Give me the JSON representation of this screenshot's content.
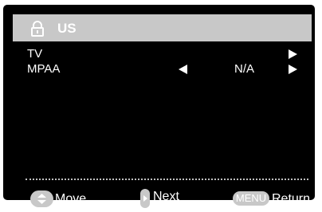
{
  "header": {
    "title": "US",
    "icon": "lock-icon"
  },
  "rows": [
    {
      "label": "TV",
      "value": "",
      "has_left_arrow": false,
      "has_right_arrow": true
    },
    {
      "label": "MPAA",
      "value": "N/A",
      "has_left_arrow": true,
      "has_right_arrow": true
    }
  ],
  "footer": {
    "move_label": "Move",
    "next_label": "Next",
    "menu_key": "MENU",
    "return_label": "Return"
  },
  "colors": {
    "background": "#000000",
    "title_bar": "#c8c8c8",
    "text": "#ffffff",
    "key_icon": "#c8c8c8"
  }
}
